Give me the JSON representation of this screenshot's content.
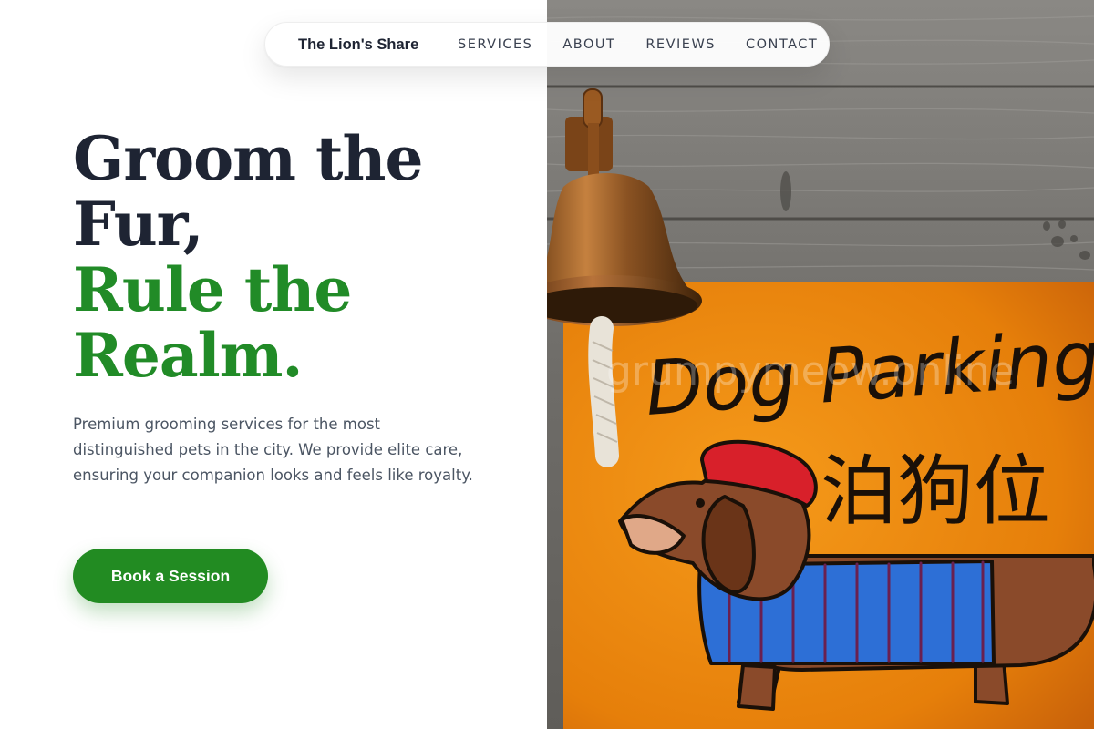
{
  "nav": {
    "brand": "The Lion's Share",
    "links": [
      "SERVICES",
      "ABOUT",
      "REVIEWS",
      "CONTACT"
    ]
  },
  "hero": {
    "headline_line1": "Groom the",
    "headline_line2": "Fur,",
    "headline_line3": "Rule the",
    "headline_line4": "Realm.",
    "description": "Premium grooming services for the most distinguished pets in the city. We provide elite care, ensuring your companion looks and feels like royalty.",
    "cta_label": "Book a Session"
  },
  "image": {
    "sign_text_en": "Dog Parking",
    "sign_text_zh": "泊狗位",
    "watermark": "grumpymeow.online"
  },
  "colors": {
    "headline_dark": "#1e2433",
    "accent_green": "#228b22",
    "body_text": "#4b5563",
    "sign_orange": "#f08a10"
  }
}
